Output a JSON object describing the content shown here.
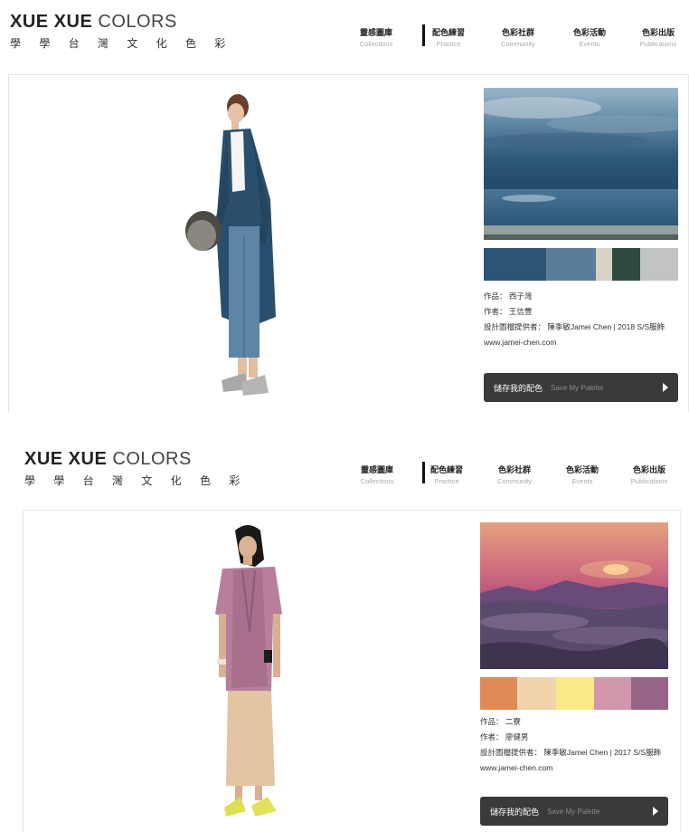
{
  "site": {
    "logo_bold": "XUE XUE",
    "logo_light": "COLORS",
    "logo_sub": "學 學 台 灣 文 化 色 彩"
  },
  "nav": [
    {
      "zh": "靈感圖庫",
      "en": "Collections",
      "active": false
    },
    {
      "zh": "配色練習",
      "en": "Practice",
      "active": true
    },
    {
      "zh": "色彩社群",
      "en": "Community",
      "active": false
    },
    {
      "zh": "色彩活動",
      "en": "Events",
      "active": false
    },
    {
      "zh": "色彩出版",
      "en": "Publications",
      "active": false
    }
  ],
  "panels": [
    {
      "work": "作品： 西子灣",
      "author": "作者： 王信豐",
      "credit": "設計圖檔提供者： 陳季敏Jamei Chen | 2018 S/S服飾 www.jamei-chen.com",
      "palette": [
        "#2b5573",
        "#5a7d99",
        "#d8d2c4",
        "#2e4a3e",
        "#c2c4c4"
      ],
      "save_zh": "儲存我的配色",
      "save_en": "Save My Palette"
    },
    {
      "work": "作品： 二寮",
      "author": "作者： 廖健男",
      "credit": "設計圖檔提供者： 陳季敏Jamei Chen | 2017 S/S服飾 www.jamei-chen.com",
      "palette": [
        "#e08b56",
        "#f2d3ac",
        "#f8e989",
        "#d195ac",
        "#986486"
      ],
      "save_zh": "儲存我的配色",
      "save_en": "Save My Palette"
    }
  ]
}
